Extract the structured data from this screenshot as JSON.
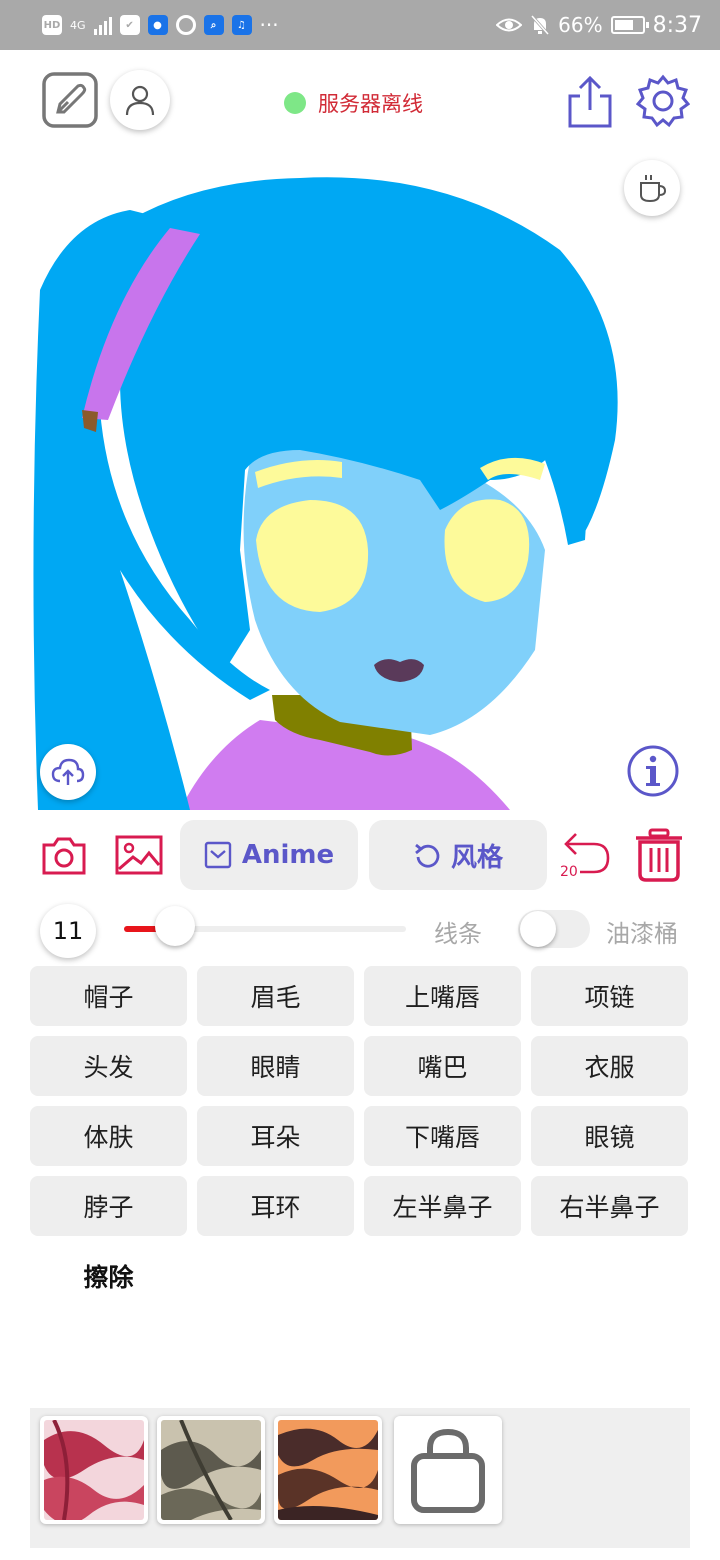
{
  "status_bar": {
    "left_icons": [
      "hd-icon",
      "signal-4g-icon",
      "shield-icon",
      "bulb-icon",
      "circle-icon",
      "search-app-icon",
      "music-icon",
      "more-icon"
    ],
    "network": "4G",
    "battery": "66%",
    "time": "8:37"
  },
  "header": {
    "server_status": "服务器离线",
    "status_color": "#7ee787"
  },
  "toolbar": {
    "anime_label": "Anime",
    "style_label": "风格",
    "undo_count": "20"
  },
  "brush": {
    "size": "11",
    "slider_fraction": 0.18,
    "line_label": "线条",
    "bucket_label": "油漆桶",
    "bucket_on": false
  },
  "parts": [
    "帽子",
    "眉毛",
    "上嘴唇",
    "项链",
    "头发",
    "眼睛",
    "嘴巴",
    "衣服",
    "体肤",
    "耳朵",
    "下嘴唇",
    "眼镜",
    "脖子",
    "耳环",
    "左半鼻子",
    "右半鼻子"
  ],
  "erase_label": "擦除",
  "colors": {
    "accent": "#5b57c9",
    "danger": "#d81b50",
    "hair": "#00a8f3",
    "skin": "#80d0fa",
    "eyes": "#fdfa9a",
    "hair_tie": "#c875ec",
    "neck": "#808000",
    "shirt": "#d07cf0",
    "mouth": "#5a3a5a"
  },
  "style_thumbnails": [
    "style-red-marble",
    "style-gray-stone",
    "style-orange-flame"
  ]
}
